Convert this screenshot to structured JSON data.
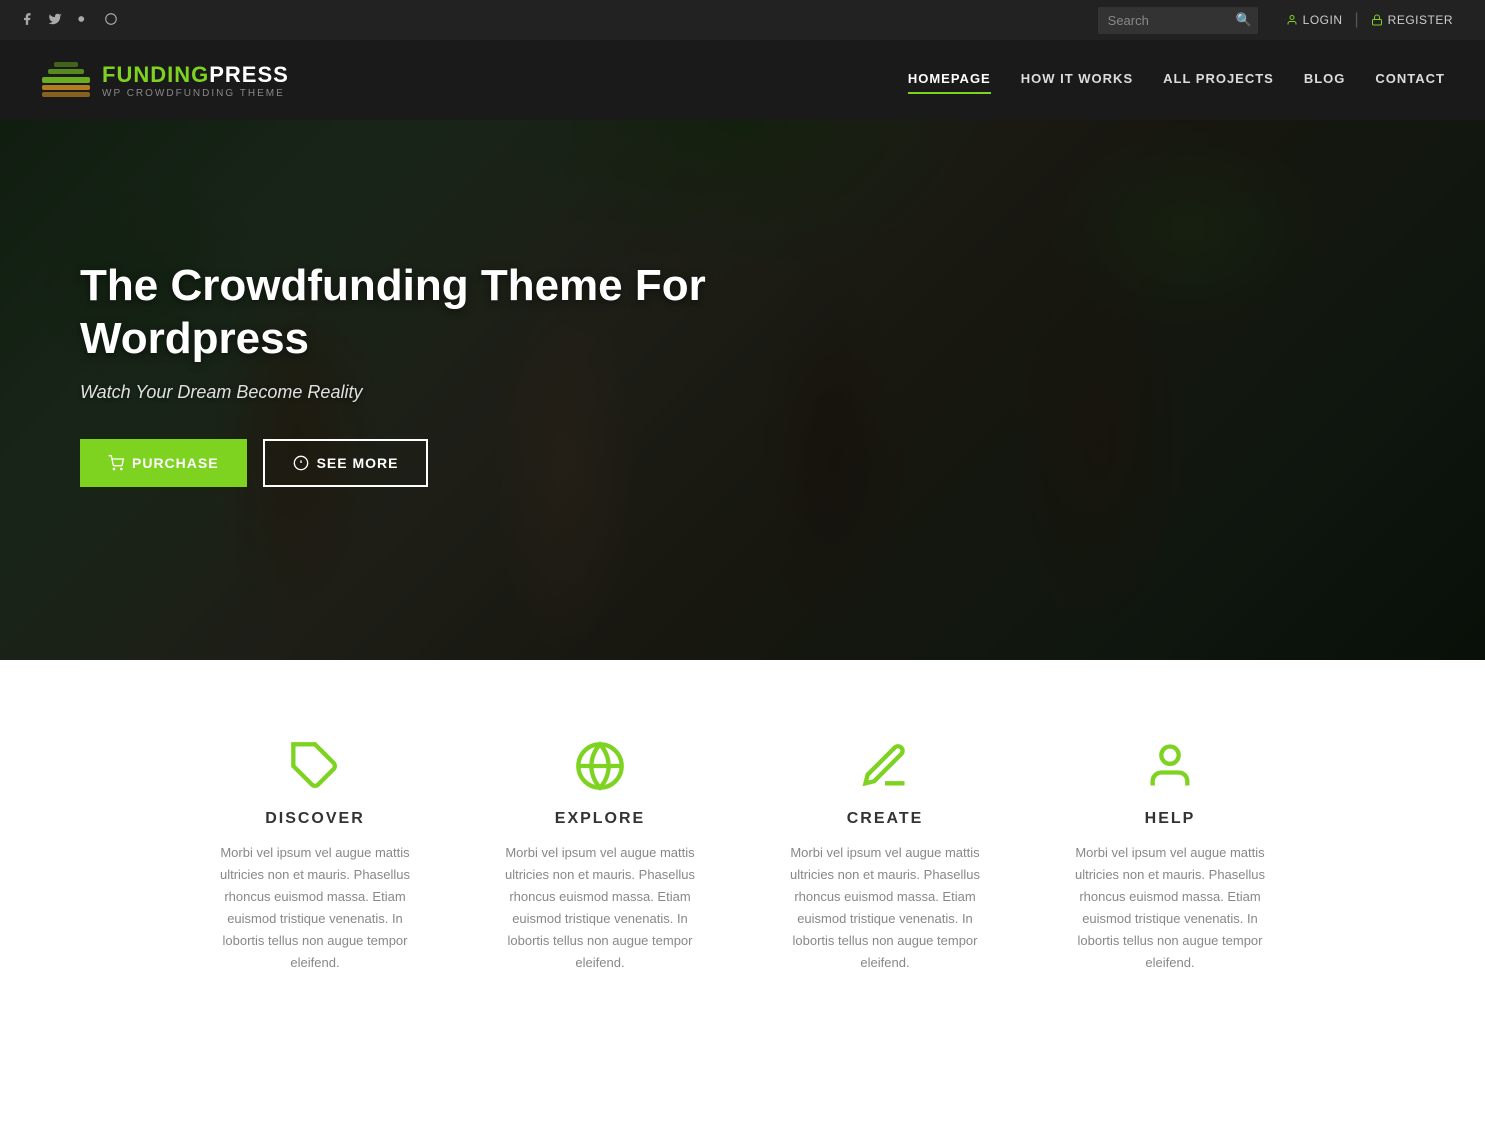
{
  "topbar": {
    "social_icons": [
      {
        "name": "facebook",
        "symbol": "f"
      },
      {
        "name": "twitter",
        "symbol": "t"
      },
      {
        "name": "google-plus",
        "symbol": "g+"
      },
      {
        "name": "skype",
        "symbol": "s"
      }
    ],
    "search_placeholder": "Search",
    "login_label": "LOGIN",
    "register_label": "REGISTER"
  },
  "header": {
    "logo": {
      "brand1": "FUNDING",
      "brand2": "PRESS",
      "subtitle": "WP CROWDFUNDING THEME"
    },
    "nav_items": [
      {
        "label": "HOMEPAGE",
        "active": true
      },
      {
        "label": "HOW IT WORKS",
        "active": false
      },
      {
        "label": "ALL PROJECTS",
        "active": false
      },
      {
        "label": "BLOG",
        "active": false
      },
      {
        "label": "CONTACT",
        "active": false
      }
    ]
  },
  "hero": {
    "title": "The Crowdfunding Theme For Wordpress",
    "subtitle": "Watch Your Dream Become Reality",
    "purchase_label": "PURCHASE",
    "seemore_label": "SEE MORE"
  },
  "features": [
    {
      "id": "discover",
      "title": "DISCOVER",
      "icon": "tag",
      "text": "Morbi vel ipsum vel augue mattis ultricies non et mauris. Phasellus rhoncus euismod massa. Etiam euismod tristique venenatis. In lobortis tellus non augue tempor eleifend."
    },
    {
      "id": "explore",
      "title": "EXPLORE",
      "icon": "globe",
      "text": "Morbi vel ipsum vel augue mattis ultricies non et mauris. Phasellus rhoncus euismod massa. Etiam euismod tristique venenatis. In lobortis tellus non augue tempor eleifend."
    },
    {
      "id": "create",
      "title": "CREATE",
      "icon": "pencil",
      "text": "Morbi vel ipsum vel augue mattis ultricies non et mauris. Phasellus rhoncus euismod massa. Etiam euismod tristique venenatis. In lobortis tellus non augue tempor eleifend."
    },
    {
      "id": "help",
      "title": "HELP",
      "icon": "person",
      "text": "Morbi vel ipsum vel augue mattis ultricies non et mauris. Phasellus rhoncus euismod massa. Etiam euismod tristique venenatis. In lobortis tellus non augue tempor eleifend."
    }
  ]
}
